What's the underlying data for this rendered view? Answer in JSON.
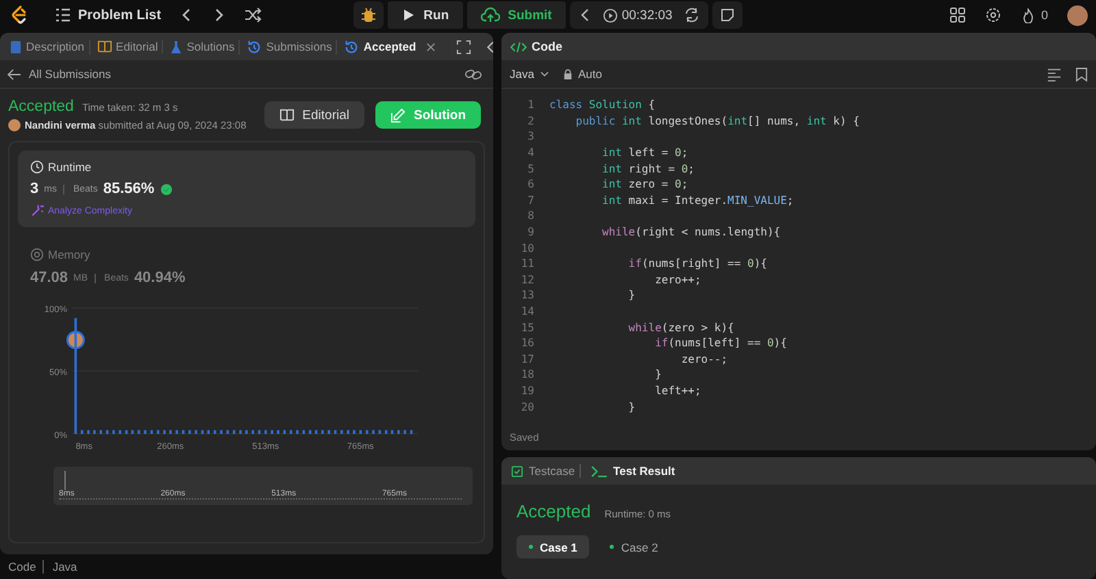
{
  "topbar": {
    "problem_list": "Problem List",
    "run": "Run",
    "submit": "Submit",
    "timer": "00:32:03",
    "streak": "0"
  },
  "left_tabs": [
    {
      "label": "Description",
      "selected": false,
      "kind": "doc"
    },
    {
      "label": "Editorial",
      "selected": false,
      "kind": "book"
    },
    {
      "label": "Solutions",
      "selected": false,
      "kind": "flask"
    },
    {
      "label": "Submissions",
      "selected": false,
      "kind": "history"
    },
    {
      "label": "Accepted",
      "selected": true,
      "kind": "history"
    }
  ],
  "back_link": "All Submissions",
  "result": {
    "status": "Accepted",
    "time_taken": "Time taken: 32 m 3 s",
    "user": "Nandini verma",
    "submitted": "submitted at Aug 09, 2024 23:08",
    "editorial_button": "Editorial",
    "solution_button": "Solution"
  },
  "runtime": {
    "title": "Runtime",
    "value": "3",
    "unit": "ms",
    "beats_label": "Beats",
    "beats": "85.56%",
    "analyze": "Analyze Complexity"
  },
  "memory": {
    "title": "Memory",
    "value": "47.08",
    "unit": "MB",
    "beats_label": "Beats",
    "beats": "40.94%"
  },
  "distribution": {
    "chart_data": {
      "type": "bar",
      "x": [
        8,
        25,
        42,
        58,
        75,
        92,
        109,
        126,
        143,
        159,
        176,
        193,
        210,
        227,
        244,
        260,
        277,
        294,
        311,
        328,
        345,
        361,
        378,
        395,
        412,
        429,
        446,
        462,
        479,
        496,
        513,
        530,
        546,
        563,
        580,
        597,
        614,
        631,
        647,
        664,
        681,
        698,
        715,
        732,
        748,
        765,
        782,
        799,
        816,
        833,
        849,
        866,
        883,
        900
      ],
      "series": [
        {
          "color": "#2b6fd6",
          "values": [
            92,
            3,
            3,
            3,
            3,
            3,
            3,
            3,
            3,
            3,
            3,
            3,
            3,
            3,
            3,
            3,
            3,
            3,
            3,
            3,
            3,
            3,
            3,
            3,
            3,
            3,
            3,
            3,
            3,
            3,
            3,
            3,
            3,
            3,
            3,
            3,
            3,
            3,
            3,
            3,
            3,
            3,
            3,
            3,
            3,
            3,
            3,
            3,
            3,
            3,
            3,
            3,
            3,
            3
          ]
        }
      ],
      "xlim": [
        0,
        910
      ],
      "ylim": [
        0,
        100
      ],
      "xticks": [
        {
          "value": 8,
          "label": "8ms"
        },
        {
          "value": 260,
          "label": "260ms"
        },
        {
          "value": 513,
          "label": "513ms"
        },
        {
          "value": 765,
          "label": "765ms"
        }
      ],
      "yticks": [
        {
          "value": 0,
          "label": "0%"
        },
        {
          "value": 50,
          "label": "50%"
        },
        {
          "value": 100,
          "label": "100%"
        }
      ]
    },
    "brush_labels": [
      "8ms",
      "260ms",
      "513ms",
      "765ms"
    ]
  },
  "footer": {
    "code": "Code",
    "language": "Java"
  },
  "editor": {
    "tab": "Code",
    "language": "Java",
    "mode": "Auto",
    "status": "Saved",
    "lines": [
      {
        "number": "1",
        "tokens": [
          {
            "text": "class ",
            "kind": "keyword"
          },
          {
            "text": "Solution",
            "kind": "type"
          },
          {
            "text": " {",
            "kind": "plain"
          }
        ]
      },
      {
        "number": "2",
        "tokens": [
          {
            "text": "    public ",
            "kind": "keyword"
          },
          {
            "text": "int ",
            "kind": "type"
          },
          {
            "text": "longestOnes",
            "kind": "plain"
          },
          {
            "text": "(",
            "kind": "plain"
          },
          {
            "text": "int",
            "kind": "type"
          },
          {
            "text": "[] nums, ",
            "kind": "plain"
          },
          {
            "text": "int ",
            "kind": "type"
          },
          {
            "text": "k) {",
            "kind": "plain"
          }
        ]
      },
      {
        "number": "3"
      },
      {
        "number": "4",
        "tokens": [
          {
            "text": "        int ",
            "kind": "type"
          },
          {
            "text": "left = ",
            "kind": "plain"
          },
          {
            "text": "0",
            "kind": "number"
          },
          {
            "text": ";",
            "kind": "plain"
          }
        ]
      },
      {
        "number": "5",
        "tokens": [
          {
            "text": "        int ",
            "kind": "type"
          },
          {
            "text": "right = ",
            "kind": "plain"
          },
          {
            "text": "0",
            "kind": "number"
          },
          {
            "text": ";",
            "kind": "plain"
          }
        ]
      },
      {
        "number": "6",
        "tokens": [
          {
            "text": "        int ",
            "kind": "type"
          },
          {
            "text": "zero = ",
            "kind": "plain"
          },
          {
            "text": "0",
            "kind": "number"
          },
          {
            "text": ";",
            "kind": "plain"
          }
        ]
      },
      {
        "number": "7",
        "tokens": [
          {
            "text": "        int ",
            "kind": "type"
          },
          {
            "text": "maxi = Integer.",
            "kind": "plain"
          },
          {
            "text": "MIN_VALUE",
            "kind": "constant"
          },
          {
            "text": ";",
            "kind": "plain"
          }
        ]
      },
      {
        "number": "8"
      },
      {
        "number": "9",
        "tokens": [
          {
            "text": "        while",
            "kind": "control"
          },
          {
            "text": "(right < nums.length){",
            "kind": "plain"
          }
        ]
      },
      {
        "number": "10"
      },
      {
        "number": "11",
        "tokens": [
          {
            "text": "            if",
            "kind": "control"
          },
          {
            "text": "(nums[right] == ",
            "kind": "plain"
          },
          {
            "text": "0",
            "kind": "number"
          },
          {
            "text": "){",
            "kind": "plain"
          }
        ]
      },
      {
        "number": "12",
        "tokens": [
          {
            "text": "                zero++;",
            "kind": "plain"
          }
        ]
      },
      {
        "number": "13",
        "tokens": [
          {
            "text": "            }",
            "kind": "plain"
          }
        ]
      },
      {
        "number": "14"
      },
      {
        "number": "15",
        "tokens": [
          {
            "text": "            while",
            "kind": "control"
          },
          {
            "text": "(zero > k){",
            "kind": "plain"
          }
        ]
      },
      {
        "number": "16",
        "tokens": [
          {
            "text": "                if",
            "kind": "control"
          },
          {
            "text": "(nums[left] == ",
            "kind": "plain"
          },
          {
            "text": "0",
            "kind": "number"
          },
          {
            "text": "){",
            "kind": "plain"
          }
        ]
      },
      {
        "number": "17",
        "tokens": [
          {
            "text": "                    zero--;",
            "kind": "plain"
          }
        ]
      },
      {
        "number": "18",
        "tokens": [
          {
            "text": "                }",
            "kind": "plain"
          }
        ]
      },
      {
        "number": "19",
        "tokens": [
          {
            "text": "                left++;",
            "kind": "plain"
          }
        ]
      },
      {
        "number": "20",
        "tokens": [
          {
            "text": "            }",
            "kind": "plain"
          }
        ]
      }
    ]
  },
  "test_tabs": [
    {
      "label": "Testcase",
      "selected": false,
      "kind": "check"
    },
    {
      "label": "Test Result",
      "selected": true,
      "kind": "terminal"
    }
  ],
  "test_result": {
    "status": "Accepted",
    "runtime": "Runtime: 0 ms"
  },
  "cases": [
    {
      "label": "Case 1",
      "selected": true
    },
    {
      "label": "Case 2",
      "selected": false
    }
  ]
}
